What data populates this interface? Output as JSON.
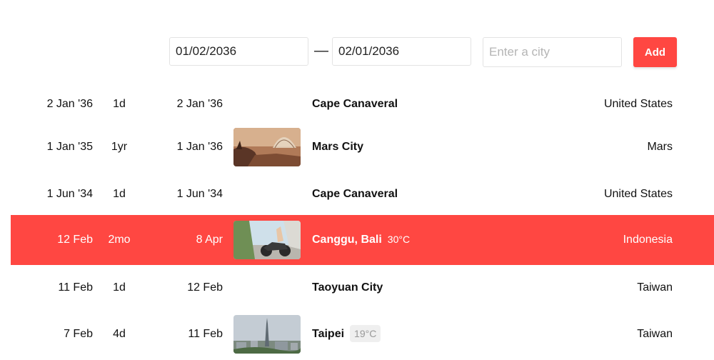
{
  "form": {
    "date_from": "01/02/2036",
    "date_separator": "—",
    "date_to": "02/01/2036",
    "city_placeholder": "Enter a city",
    "add_label": "Add"
  },
  "colors": {
    "accent": "#ff4742",
    "temp_pill_bg": "#efefef"
  },
  "trips": [
    {
      "start": "2 Jan '36",
      "duration": "1d",
      "end": "2 Jan '36",
      "city": "Cape Canaveral",
      "temp": "",
      "country": "United States",
      "photo": "",
      "highlighted": false
    },
    {
      "start": "1 Jan '35",
      "duration": "1yr",
      "end": "1 Jan '36",
      "city": "Mars City",
      "temp": "",
      "country": "Mars",
      "photo": "mars-dome-photo",
      "highlighted": false
    },
    {
      "start": "1 Jun '34",
      "duration": "1d",
      "end": "1 Jun '34",
      "city": "Cape Canaveral",
      "temp": "",
      "country": "United States",
      "photo": "",
      "highlighted": false
    },
    {
      "start": "12 Feb",
      "duration": "2mo",
      "end": "8 Apr",
      "city": "Canggu, Bali",
      "temp": "30°C",
      "country": "Indonesia",
      "photo": "motorbike-street-photo",
      "highlighted": true
    },
    {
      "start": "11 Feb",
      "duration": "1d",
      "end": "12 Feb",
      "city": "Taoyuan City",
      "temp": "",
      "country": "Taiwan",
      "photo": "",
      "highlighted": false
    },
    {
      "start": "7 Feb",
      "duration": "4d",
      "end": "11 Feb",
      "city": "Taipei",
      "temp": "19°C",
      "country": "Taiwan",
      "photo": "taipei-skyline-photo",
      "highlighted": false
    }
  ]
}
